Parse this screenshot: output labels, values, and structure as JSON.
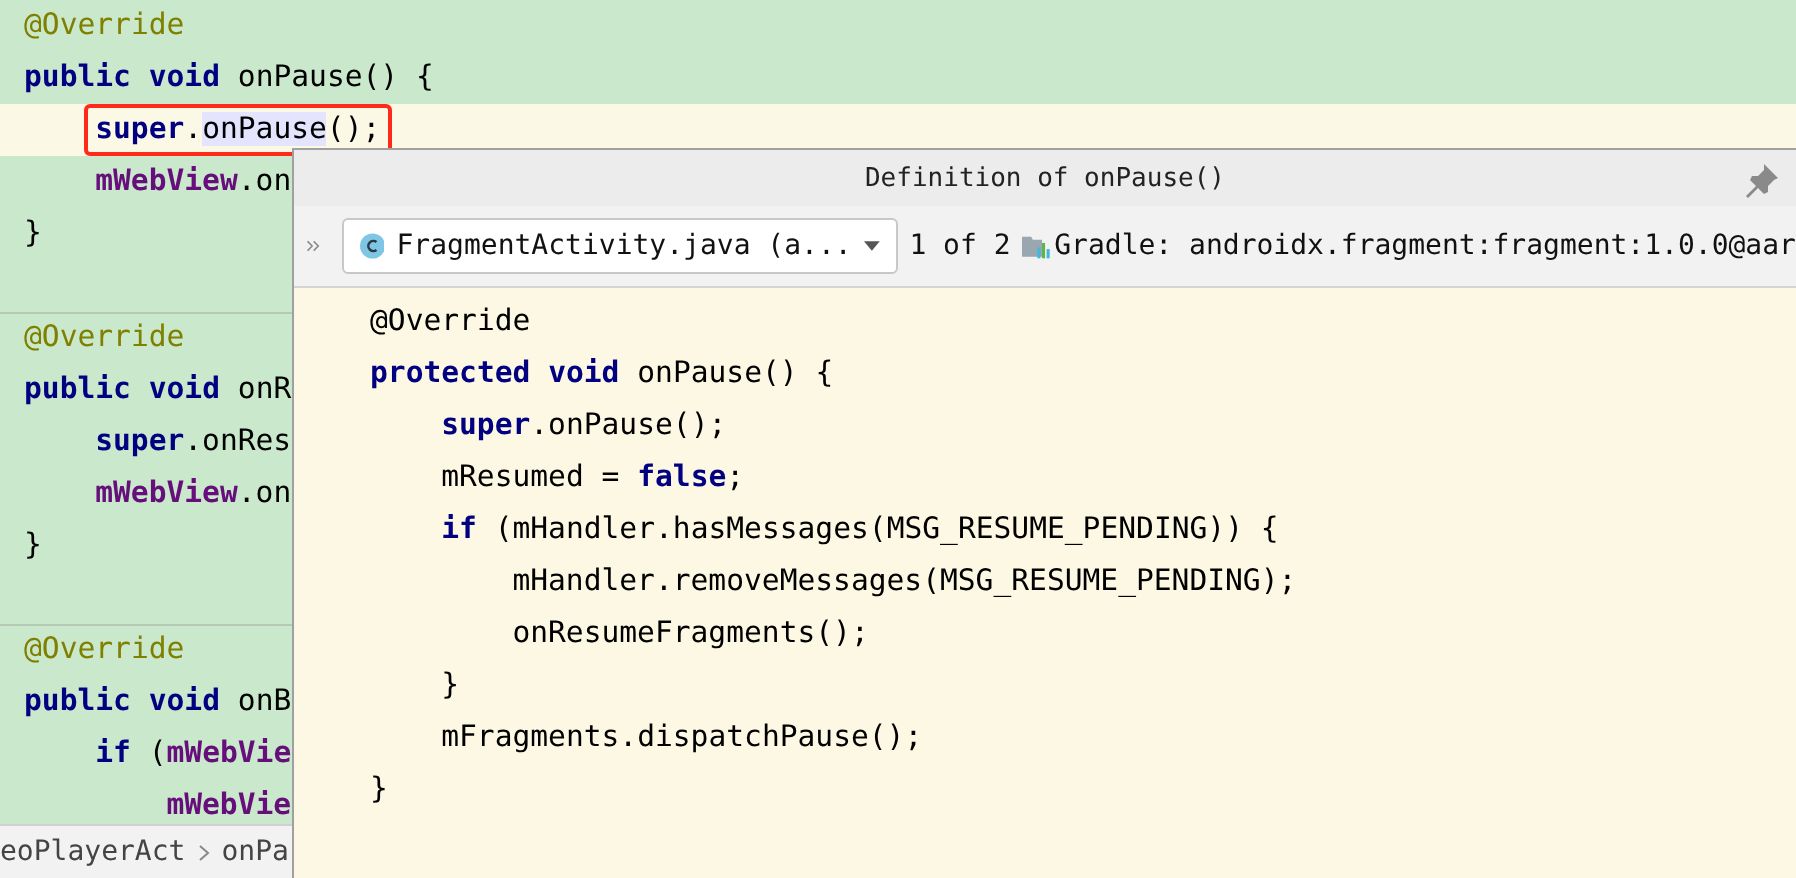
{
  "editor": {
    "blocks": [
      {
        "lines": [
          {
            "tokens": [
              {
                "kind": "annotation",
                "text": "@Override"
              }
            ]
          },
          {
            "tokens": [
              {
                "kind": "keyword",
                "text": "public void "
              },
              {
                "kind": "plain",
                "text": "onPause() {"
              }
            ],
            "children": [
              {
                "current": true,
                "boxed": true,
                "tokens": [
                  {
                    "kind": "keyword",
                    "text": "super"
                  },
                  {
                    "kind": "plain",
                    "text": "."
                  },
                  {
                    "kind": "match",
                    "text": "onPause"
                  },
                  {
                    "kind": "plain",
                    "text": "();"
                  }
                ]
              },
              {
                "current": false,
                "boxed": false,
                "tokens": [
                  {
                    "kind": "field",
                    "text": "mWebView"
                  },
                  {
                    "kind": "plain",
                    "text": ".on"
                  }
                ]
              }
            ]
          },
          {
            "tokens": [
              {
                "kind": "plain",
                "text": "}"
              }
            ]
          }
        ]
      },
      {
        "lines": [
          {
            "tokens": [
              {
                "kind": "annotation",
                "text": "@Override"
              }
            ]
          },
          {
            "tokens": [
              {
                "kind": "keyword",
                "text": "public void "
              },
              {
                "kind": "plain",
                "text": "onR"
              }
            ],
            "children": [
              {
                "current": false,
                "boxed": false,
                "tokens": [
                  {
                    "kind": "keyword",
                    "text": "super"
                  },
                  {
                    "kind": "plain",
                    "text": ".onRes"
                  }
                ]
              },
              {
                "current": false,
                "boxed": false,
                "tokens": [
                  {
                    "kind": "field",
                    "text": "mWebView"
                  },
                  {
                    "kind": "plain",
                    "text": ".on"
                  }
                ]
              }
            ]
          },
          {
            "tokens": [
              {
                "kind": "plain",
                "text": "}"
              }
            ]
          }
        ]
      },
      {
        "lines": [
          {
            "tokens": [
              {
                "kind": "annotation",
                "text": "@Override"
              }
            ]
          },
          {
            "tokens": [
              {
                "kind": "keyword",
                "text": "public void "
              },
              {
                "kind": "plain",
                "text": "onB"
              }
            ],
            "children": [
              {
                "current": false,
                "boxed": false,
                "tokens": [
                  {
                    "kind": "keyword",
                    "text": "if "
                  },
                  {
                    "kind": "plain",
                    "text": "("
                  },
                  {
                    "kind": "field",
                    "text": "mWebVie"
                  }
                ],
                "children": [
                  {
                    "current": false,
                    "boxed": false,
                    "tokens": [
                      {
                        "kind": "field",
                        "text": "mWebVie"
                      }
                    ]
                  }
                ]
              }
            ]
          }
        ]
      }
    ]
  },
  "breadcrumbs": [
    "eoPlayerAct",
    "onPa"
  ],
  "popup": {
    "title": "Definition of onPause()",
    "file": "FragmentActivity.java (a...",
    "count": "1 of 2",
    "library": "Gradle: androidx.fragment:fragment:1.0.0@aar",
    "lines": [
      {
        "tokens": [
          {
            "kind": "plain",
            "text": "@Override"
          }
        ]
      },
      {
        "tokens": [
          {
            "kind": "keyword",
            "text": "protected void "
          },
          {
            "kind": "plain",
            "text": "onPause() {"
          }
        ],
        "children": [
          {
            "tokens": [
              {
                "kind": "keyword",
                "text": "super"
              },
              {
                "kind": "plain",
                "text": ".onPause();"
              }
            ]
          },
          {
            "tokens": [
              {
                "kind": "plain",
                "text": "mResumed = "
              },
              {
                "kind": "keyword",
                "text": "false"
              },
              {
                "kind": "plain",
                "text": ";"
              }
            ]
          },
          {
            "tokens": [
              {
                "kind": "keyword",
                "text": "if "
              },
              {
                "kind": "plain",
                "text": "(mHandler.hasMessages(MSG_RESUME_PENDING)) {"
              }
            ],
            "children": [
              {
                "tokens": [
                  {
                    "kind": "plain",
                    "text": "mHandler.removeMessages(MSG_RESUME_PENDING);"
                  }
                ]
              },
              {
                "tokens": [
                  {
                    "kind": "plain",
                    "text": "onResumeFragments();"
                  }
                ]
              }
            ]
          },
          {
            "tokens": [
              {
                "kind": "plain",
                "text": "}"
              }
            ]
          },
          {
            "tokens": [
              {
                "kind": "plain",
                "text": "mFragments.dispatchPause();"
              }
            ]
          }
        ]
      },
      {
        "tokens": [
          {
            "kind": "plain",
            "text": "}"
          }
        ]
      }
    ]
  }
}
